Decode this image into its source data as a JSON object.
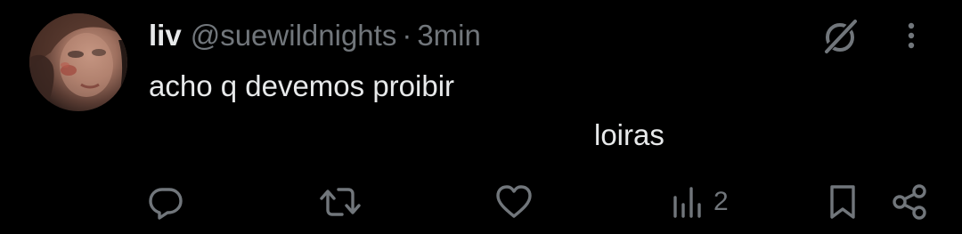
{
  "tweet": {
    "display_name": "liv",
    "handle": "@suewildnights",
    "separator": "·",
    "time": "3min",
    "text_line1": "acho q devemos proibir",
    "text_line2": "loiras"
  },
  "actions": {
    "views_count": "2"
  },
  "icons": {
    "reply": "reply-icon",
    "retweet": "retweet-icon",
    "like": "heart-icon",
    "views": "views-bar-chart-icon",
    "bookmark": "bookmark-icon",
    "share": "share-icon",
    "grok": "grok-icon",
    "more": "more-vertical-icon"
  },
  "colors": {
    "background": "#000000",
    "primary_text": "#e7e9ea",
    "secondary_text": "#71767b"
  }
}
